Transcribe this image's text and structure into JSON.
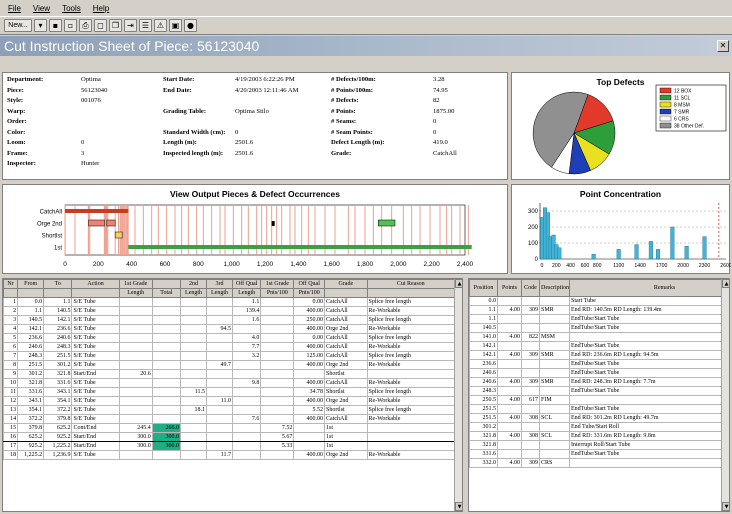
{
  "menu": [
    "File",
    "View",
    "Tools",
    "Help"
  ],
  "toolbar": {
    "new_label": "New..."
  },
  "window": {
    "title": "Cut Instruction Sheet of Piece: 56123040"
  },
  "info": {
    "col1": [
      [
        "Department:",
        "Optima"
      ],
      [
        "Piece:",
        "56123040"
      ],
      [
        "Style:",
        "001076"
      ],
      [
        "Warp:",
        ""
      ],
      [
        "Order:",
        ""
      ],
      [
        "Color:",
        ""
      ],
      [
        "Loom:",
        "0"
      ],
      [
        "Frame:",
        "3"
      ],
      [
        "Inspector:",
        "Hunter"
      ]
    ],
    "col2": [
      [
        "Start Date:",
        "4/19/2003 6:22:26 PM"
      ],
      [
        "End Date:",
        "4/20/2003 12:11:46 AM"
      ],
      [
        "",
        ""
      ],
      [
        "Grading Table:",
        "Optima Stilo"
      ],
      [
        "",
        ""
      ],
      [
        "Standard Width (cm):",
        "0"
      ],
      [
        "Length (m):",
        "2501.6"
      ],
      [
        "Inspected length (m):",
        "2501.6"
      ]
    ],
    "col3": [
      [
        "# Defects/100m:",
        "3.28"
      ],
      [
        "# Points/100m:",
        "74.95"
      ],
      [
        "# Defects:",
        "82"
      ],
      [
        "# Points:",
        "1875.00"
      ],
      [
        "# Seams:",
        "0"
      ],
      [
        "# Seam Points:",
        "0"
      ],
      [
        "Defect Length (m):",
        "419.0"
      ],
      [
        "Grade:",
        "CatchAll"
      ]
    ]
  },
  "pie": {
    "title": "Top Defects",
    "legend": [
      "12 BOX",
      "11 SCL",
      "8 MSM",
      "7 SMR",
      "6 CRS",
      "38 Other Def."
    ],
    "values": [
      12,
      11,
      8,
      7,
      6,
      38
    ],
    "colors": [
      "#e23a2a",
      "#2e9e3a",
      "#e8e020",
      "#1f3fb8",
      "#ffffff",
      "#909090"
    ]
  },
  "output": {
    "title": "View Output Pieces & Defect Occurrences",
    "rows": [
      "CatchAll",
      "Orge 2nd",
      "Shortlst",
      "1st"
    ],
    "xticks": [
      "0",
      "200",
      "400",
      "600",
      "800",
      "1,000",
      "1,200",
      "1,400",
      "1,600",
      "1,800",
      "2,000",
      "2,200",
      "2,400"
    ]
  },
  "points": {
    "title": "Point Concentration",
    "yticks": [
      "300",
      "200",
      "100",
      "0"
    ],
    "xticks": [
      "0",
      "200",
      "400",
      "600",
      "800",
      "1100",
      "1400",
      "1700",
      "2000",
      "2300",
      "2600"
    ],
    "bars": [
      [
        30,
        260
      ],
      [
        70,
        320
      ],
      [
        110,
        290
      ],
      [
        150,
        140
      ],
      [
        190,
        150
      ],
      [
        230,
        90
      ],
      [
        270,
        70
      ],
      [
        750,
        30
      ],
      [
        1100,
        60
      ],
      [
        1350,
        90
      ],
      [
        1550,
        110
      ],
      [
        1650,
        60
      ],
      [
        1850,
        200
      ],
      [
        2050,
        80
      ],
      [
        2300,
        140
      ]
    ]
  },
  "left_table": {
    "headers1": [
      "Nr",
      "From",
      "To",
      "Action",
      "1st Grade",
      "",
      "2nd",
      "3rd",
      "Off Qual",
      "1st Grade",
      "Off Qual",
      "Grade",
      "Cut Reason"
    ],
    "headers2": [
      "",
      "",
      "",
      "",
      "Length",
      "Total",
      "Length",
      "Length",
      "Length",
      "Pnts/100",
      "Pnts/100",
      "",
      ""
    ],
    "rows": [
      [
        "1",
        "0.0",
        "1.1",
        "S/E Tube",
        "",
        "",
        "",
        "",
        "1.1",
        "",
        "0.00",
        "CatchAll",
        "Splice free length"
      ],
      [
        "2",
        "1.1",
        "140.5",
        "S/E Tube",
        "",
        "",
        "",
        "",
        "139.4",
        "",
        "400.00",
        "CatchAll",
        "Re-Workable"
      ],
      [
        "3",
        "140.5",
        "142.1",
        "S/E Tube",
        "",
        "",
        "",
        "",
        "1.6",
        "",
        "250.00",
        "CatchAll",
        "Splice free length"
      ],
      [
        "4",
        "142.1",
        "236.6",
        "S/E Tube",
        "",
        "",
        "",
        "94.5",
        "",
        "",
        "400.00",
        "Orge 2nd",
        "Re-Workable"
      ],
      [
        "5",
        "236.6",
        "240.6",
        "S/E Tube",
        "",
        "",
        "",
        "",
        "4.0",
        "",
        "0.00",
        "CatchAll",
        "Splice free length"
      ],
      [
        "6",
        "240.6",
        "248.3",
        "S/E Tube",
        "",
        "",
        "",
        "",
        "7.7",
        "",
        "400.00",
        "CatchAll",
        "Re-Workable"
      ],
      [
        "7",
        "248.3",
        "251.5",
        "S/E Tube",
        "",
        "",
        "",
        "",
        "3.2",
        "",
        "125.00",
        "CatchAll",
        "Splice free length"
      ],
      [
        "8",
        "251.5",
        "301.2",
        "S/E Tube",
        "",
        "",
        "",
        "49.7",
        "",
        "",
        "400.00",
        "Orge 2nd",
        "Re-Workable"
      ],
      [
        "9",
        "301.2",
        "321.8",
        "Start/End",
        "20.6",
        "",
        "",
        "",
        "",
        "",
        "",
        "Shortlst",
        ""
      ],
      [
        "10",
        "321.8",
        "331.6",
        "S/E Tube",
        "",
        "",
        "",
        "",
        "9.8",
        "",
        "400.00",
        "CatchAll",
        "Re-Workable"
      ],
      [
        "11",
        "331.6",
        "343.1",
        "S/E Tube",
        "",
        "",
        "11.5",
        "",
        "",
        "",
        "34.78",
        "Shortlst",
        "Splice free length"
      ],
      [
        "12",
        "343.1",
        "354.1",
        "S/E Tube",
        "",
        "",
        "",
        "11.0",
        "",
        "",
        "400.00",
        "Orge 2nd",
        "Re-Workable"
      ],
      [
        "13",
        "354.1",
        "372.2",
        "S/E Tube",
        "",
        "",
        "18.1",
        "",
        "",
        "",
        "5.52",
        "Shortlst",
        "Splice free length"
      ],
      [
        "14",
        "372.2",
        "379.8",
        "S/E Tube",
        "",
        "",
        "",
        "",
        "7.6",
        "",
        "400.00",
        "CatchAll",
        "Re-Workable"
      ],
      [
        "15",
        "379.8",
        "625.2",
        "Cont/End",
        "245.4",
        "266.0",
        "",
        "",
        "",
        "7.52",
        "",
        "1st",
        ""
      ],
      [
        "16",
        "625.2",
        "925.2",
        "Start/End",
        "300.0",
        "300.0",
        "",
        "",
        "",
        "5.67",
        "",
        "1st",
        ""
      ],
      [
        "17",
        "925.2",
        "1,225.2",
        "Start/End",
        "300.0",
        "300.0",
        "",
        "",
        "",
        "5.33",
        "",
        "1st",
        ""
      ],
      [
        "18",
        "1,225.2",
        "1,236.9",
        "S/E Tube",
        "",
        "",
        "",
        "11.7",
        "",
        "",
        "400.00",
        "Orge 2nd",
        "Re-Workable"
      ]
    ]
  },
  "right_table": {
    "headers": [
      "Position",
      "Points",
      "Code",
      "Description",
      "Remarks"
    ],
    "rows": [
      [
        "0.0",
        "",
        "",
        "",
        "Start Tube"
      ],
      [
        "1.1",
        "4.00",
        "309",
        "SMR",
        "End RD: 140.5m  RD Length: 139.4m"
      ],
      [
        "1.1",
        "",
        "",
        "",
        "EndTube/Start Tube"
      ],
      [
        "140.5",
        "",
        "",
        "",
        "EndTube/Start Tube"
      ],
      [
        "141.0",
        "4.00",
        "822",
        "MSM",
        ""
      ],
      [
        "142.1",
        "",
        "",
        "",
        "EndTube/Start Tube"
      ],
      [
        "142.1",
        "4.00",
        "309",
        "SMR",
        "End RD: 236.6m  RD Length: 94.5m"
      ],
      [
        "236.6",
        "",
        "",
        "",
        "EndTube/Start Tube"
      ],
      [
        "240.6",
        "",
        "",
        "",
        "EndTube/Start Tube"
      ],
      [
        "240.6",
        "4.00",
        "309",
        "SMR",
        "End RD: 248.3m  RD Length: 7.7m"
      ],
      [
        "248.3",
        "",
        "",
        "",
        "EndTube/Start Tube"
      ],
      [
        "250.5",
        "4.00",
        "617",
        "FIM",
        ""
      ],
      [
        "251.5",
        "",
        "",
        "",
        "EndTube/Start Tube"
      ],
      [
        "251.5",
        "4.00",
        "308",
        "SCL",
        "End RD: 301.2m  RD Length: 49.7m"
      ],
      [
        "301.2",
        "",
        "",
        "",
        "End Tube/Start Roll"
      ],
      [
        "321.8",
        "4.00",
        "308",
        "SCL",
        "End RD: 331.6m  RD Length: 9.8m"
      ],
      [
        "321.8",
        "",
        "",
        "",
        "Interrupt Roll/Start Tube"
      ],
      [
        "331.6",
        "",
        "",
        "",
        "EndTube/Start Tube"
      ],
      [
        "332.0",
        "4.00",
        "309",
        "CRS",
        ""
      ]
    ]
  }
}
